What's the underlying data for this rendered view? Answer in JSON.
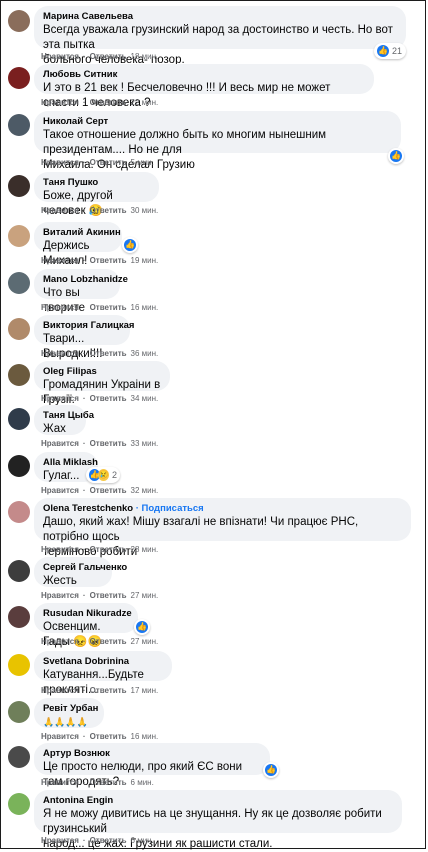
{
  "actions": {
    "like": "Нравится",
    "reply": "Ответить"
  },
  "comments": [
    {
      "author": "Марина Савельева",
      "text": "Всегда уважала грузинский народ за достоинство и честь. Но вот эта пытка\nбольного человека- позор.",
      "time": "18 мин.",
      "reactions": "21",
      "avatar_color": "#8a6d5b"
    },
    {
      "author": "Любовь Ситник",
      "text": "И это в 21 век ! Бесчеловечно !!! И весь мир не может спасти 1 человека ?",
      "time": "22 мин.",
      "avatar_color": "#7a1f1f"
    },
    {
      "author": "Николай Серт",
      "text": "Такое отношение должно быть ко многим нынешним президентам.... Но не для\nМихаила. Он сделал Грузию",
      "time": "5 мин.",
      "avatar_color": "#4d5a66"
    },
    {
      "author": "Таня Пушко",
      "text": "Боже, другой человек",
      "time": "30 мин.",
      "avatar_color": "#3a2e2a"
    },
    {
      "author": "Виталий Акинин",
      "text": "Держись Михаил!",
      "time": "19 мин.",
      "avatar_color": "#c9a27e"
    },
    {
      "author": "Mano Lobzhanidze",
      "text": "Что вы творите",
      "time": "16 мин.",
      "avatar_color": "#5c6b73"
    },
    {
      "author": "Виктория Галицкая",
      "text": "Твари... Выродки!!!!",
      "time": "36 мин.",
      "avatar_color": "#b08a6a"
    },
    {
      "author": "Oleg Filipas",
      "text": "Громадянин Украіни в Грузії.",
      "time": "34 мин.",
      "avatar_color": "#6b5a3e"
    },
    {
      "author": "Таня Цыба",
      "text": "Жах",
      "time": "33 мин.",
      "avatar_color": "#2f3b4a"
    },
    {
      "author": "Alla Miklash",
      "text": "Гулаг...",
      "time": "32 мин.",
      "reactions": "2",
      "avatar_color": "#222222"
    },
    {
      "author": "Olena Terestchenko",
      "follow": "· Подписаться",
      "text": "Дашо, який жах! Мішу взагалі не впізнати! Чи працює РНС, потрібно щось\nтерміново робити",
      "time": "28 мин.",
      "avatar_color": "#c48a8a"
    },
    {
      "author": "Сергей Гальченко",
      "text": "Жесть",
      "time": "27 мин.",
      "avatar_color": "#3d3d3d"
    },
    {
      "author": "Rusudan Nikuradze",
      "text": "Освенцим. Гады",
      "time": "27 мин.",
      "avatar_color": "#5a3d3d"
    },
    {
      "author": "Svetlana Dobrinina",
      "text": "Катування...Будьте прокляті...",
      "time": "17 мин.",
      "avatar_color": "#e8c300"
    },
    {
      "author": "Ревіт Урбан",
      "text": "🙏🙏🙏🙏",
      "time": "16 мин.",
      "avatar_color": "#6f7f5a"
    },
    {
      "author": "Артур Вознюк",
      "text": "Це просто нелюди, про який ЄС вони там городять?",
      "time": "6 мин.",
      "avatar_color": "#4a4a4a"
    },
    {
      "author": "Antonina Engin",
      "text": "Я не можу дивитись на це знущання. Ну як це дозволяє робити грузинський\nнарод... це жах. Грузини як рашисти стали.",
      "time": "6 мин.",
      "avatar_color": "#7ab35a"
    }
  ]
}
